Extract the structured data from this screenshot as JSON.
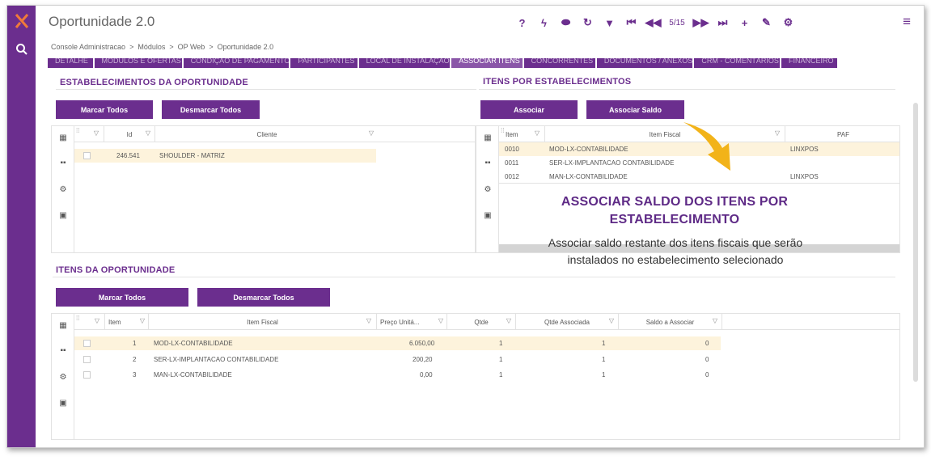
{
  "header": {
    "title": "Oportunidade 2.0",
    "page": "5/15"
  },
  "toolbar": {
    "icons": [
      "help-icon",
      "bolt-icon",
      "eraser-icon",
      "refresh-icon",
      "filter-icon",
      "first-icon",
      "prev-icon",
      "next-icon",
      "last-icon",
      "add-icon",
      "edit-icon",
      "settings-icon"
    ]
  },
  "breadcrumb": {
    "items": [
      "Console Administracao",
      ">",
      "Módulos",
      ">",
      "OP Web",
      ">",
      "Oportunidade 2.0"
    ]
  },
  "tabs": [
    "DETALHE",
    "MÓDULOS E OFERTAS",
    "CONDIÇÃO DE PAGAMENTO",
    "PARTICIPANTES",
    "LOCAL DE INSTALAÇÃO",
    "ASSOCIAR ITENS",
    "CONCORRENTES",
    "DOCUMENTOS / ANEXOS",
    "CRM - COMENTÁRIOS",
    "FINANCEIRO"
  ],
  "establishments": {
    "title": "ESTABELECIMENTOS  DA OPORTUNIDADE",
    "mark_all": "Marcar Todos",
    "unmark_all": "Desmarcar Todos",
    "columns": {
      "id": "Id",
      "client": "Cliente"
    },
    "rows": [
      {
        "id": "246.541",
        "client": "SHOULDER - MATRIZ"
      }
    ]
  },
  "items_by_est": {
    "title": "ITENS  POR ESTABELECIMENTOS",
    "associate": "Associar",
    "associate_balance": "Associar Saldo",
    "columns": {
      "item": "Item",
      "fiscal": "Item Fiscal",
      "paf": "PAF"
    },
    "rows": [
      {
        "item": "0010",
        "fiscal": "MOD-LX-CONTABILIDADE",
        "paf": "LINXPOS"
      },
      {
        "item": "0011",
        "fiscal": "SER-LX-IMPLANTACAO CONTABILIDADE",
        "paf": ""
      },
      {
        "item": "0012",
        "fiscal": "MAN-LX-CONTABILIDADE",
        "paf": "LINXPOS"
      }
    ]
  },
  "opportunity_items": {
    "title": "ITENS DA OPORTUNIDADE",
    "mark_all": "Marcar Todos",
    "unmark_all": "Desmarcar Todos",
    "columns": {
      "item": "Item",
      "fiscal": "Item Fiscal",
      "price": "Preço Unitá...",
      "qty": "Qtde",
      "qty_assoc": "Qtde Associada",
      "balance": "Saldo a Associar"
    },
    "rows": [
      {
        "item": "1",
        "fiscal": "MOD-LX-CONTABILIDADE",
        "price": "6.050,00",
        "qty": "1",
        "qty_assoc": "1",
        "balance": "0"
      },
      {
        "item": "2",
        "fiscal": "SER-LX-IMPLANTACAO CONTABILIDADE",
        "price": "200,20",
        "qty": "1",
        "qty_assoc": "1",
        "balance": "0"
      },
      {
        "item": "3",
        "fiscal": "MAN-LX-CONTABILIDADE",
        "price": "0,00",
        "qty": "1",
        "qty_assoc": "1",
        "balance": "0"
      }
    ]
  },
  "callout": {
    "title_line1": "ASSOCIAR SALDO DOS ITENS POR",
    "title_line2": "ESTABELECIMENTO",
    "text_line1": "Associar saldo restante dos itens fiscais que serão",
    "text_line2": "instalados no estabelecimento selecionado"
  },
  "colors": {
    "brand": "#6b2e8e",
    "selected_row": "#fdf3dc",
    "arrow": "#f2b319"
  }
}
